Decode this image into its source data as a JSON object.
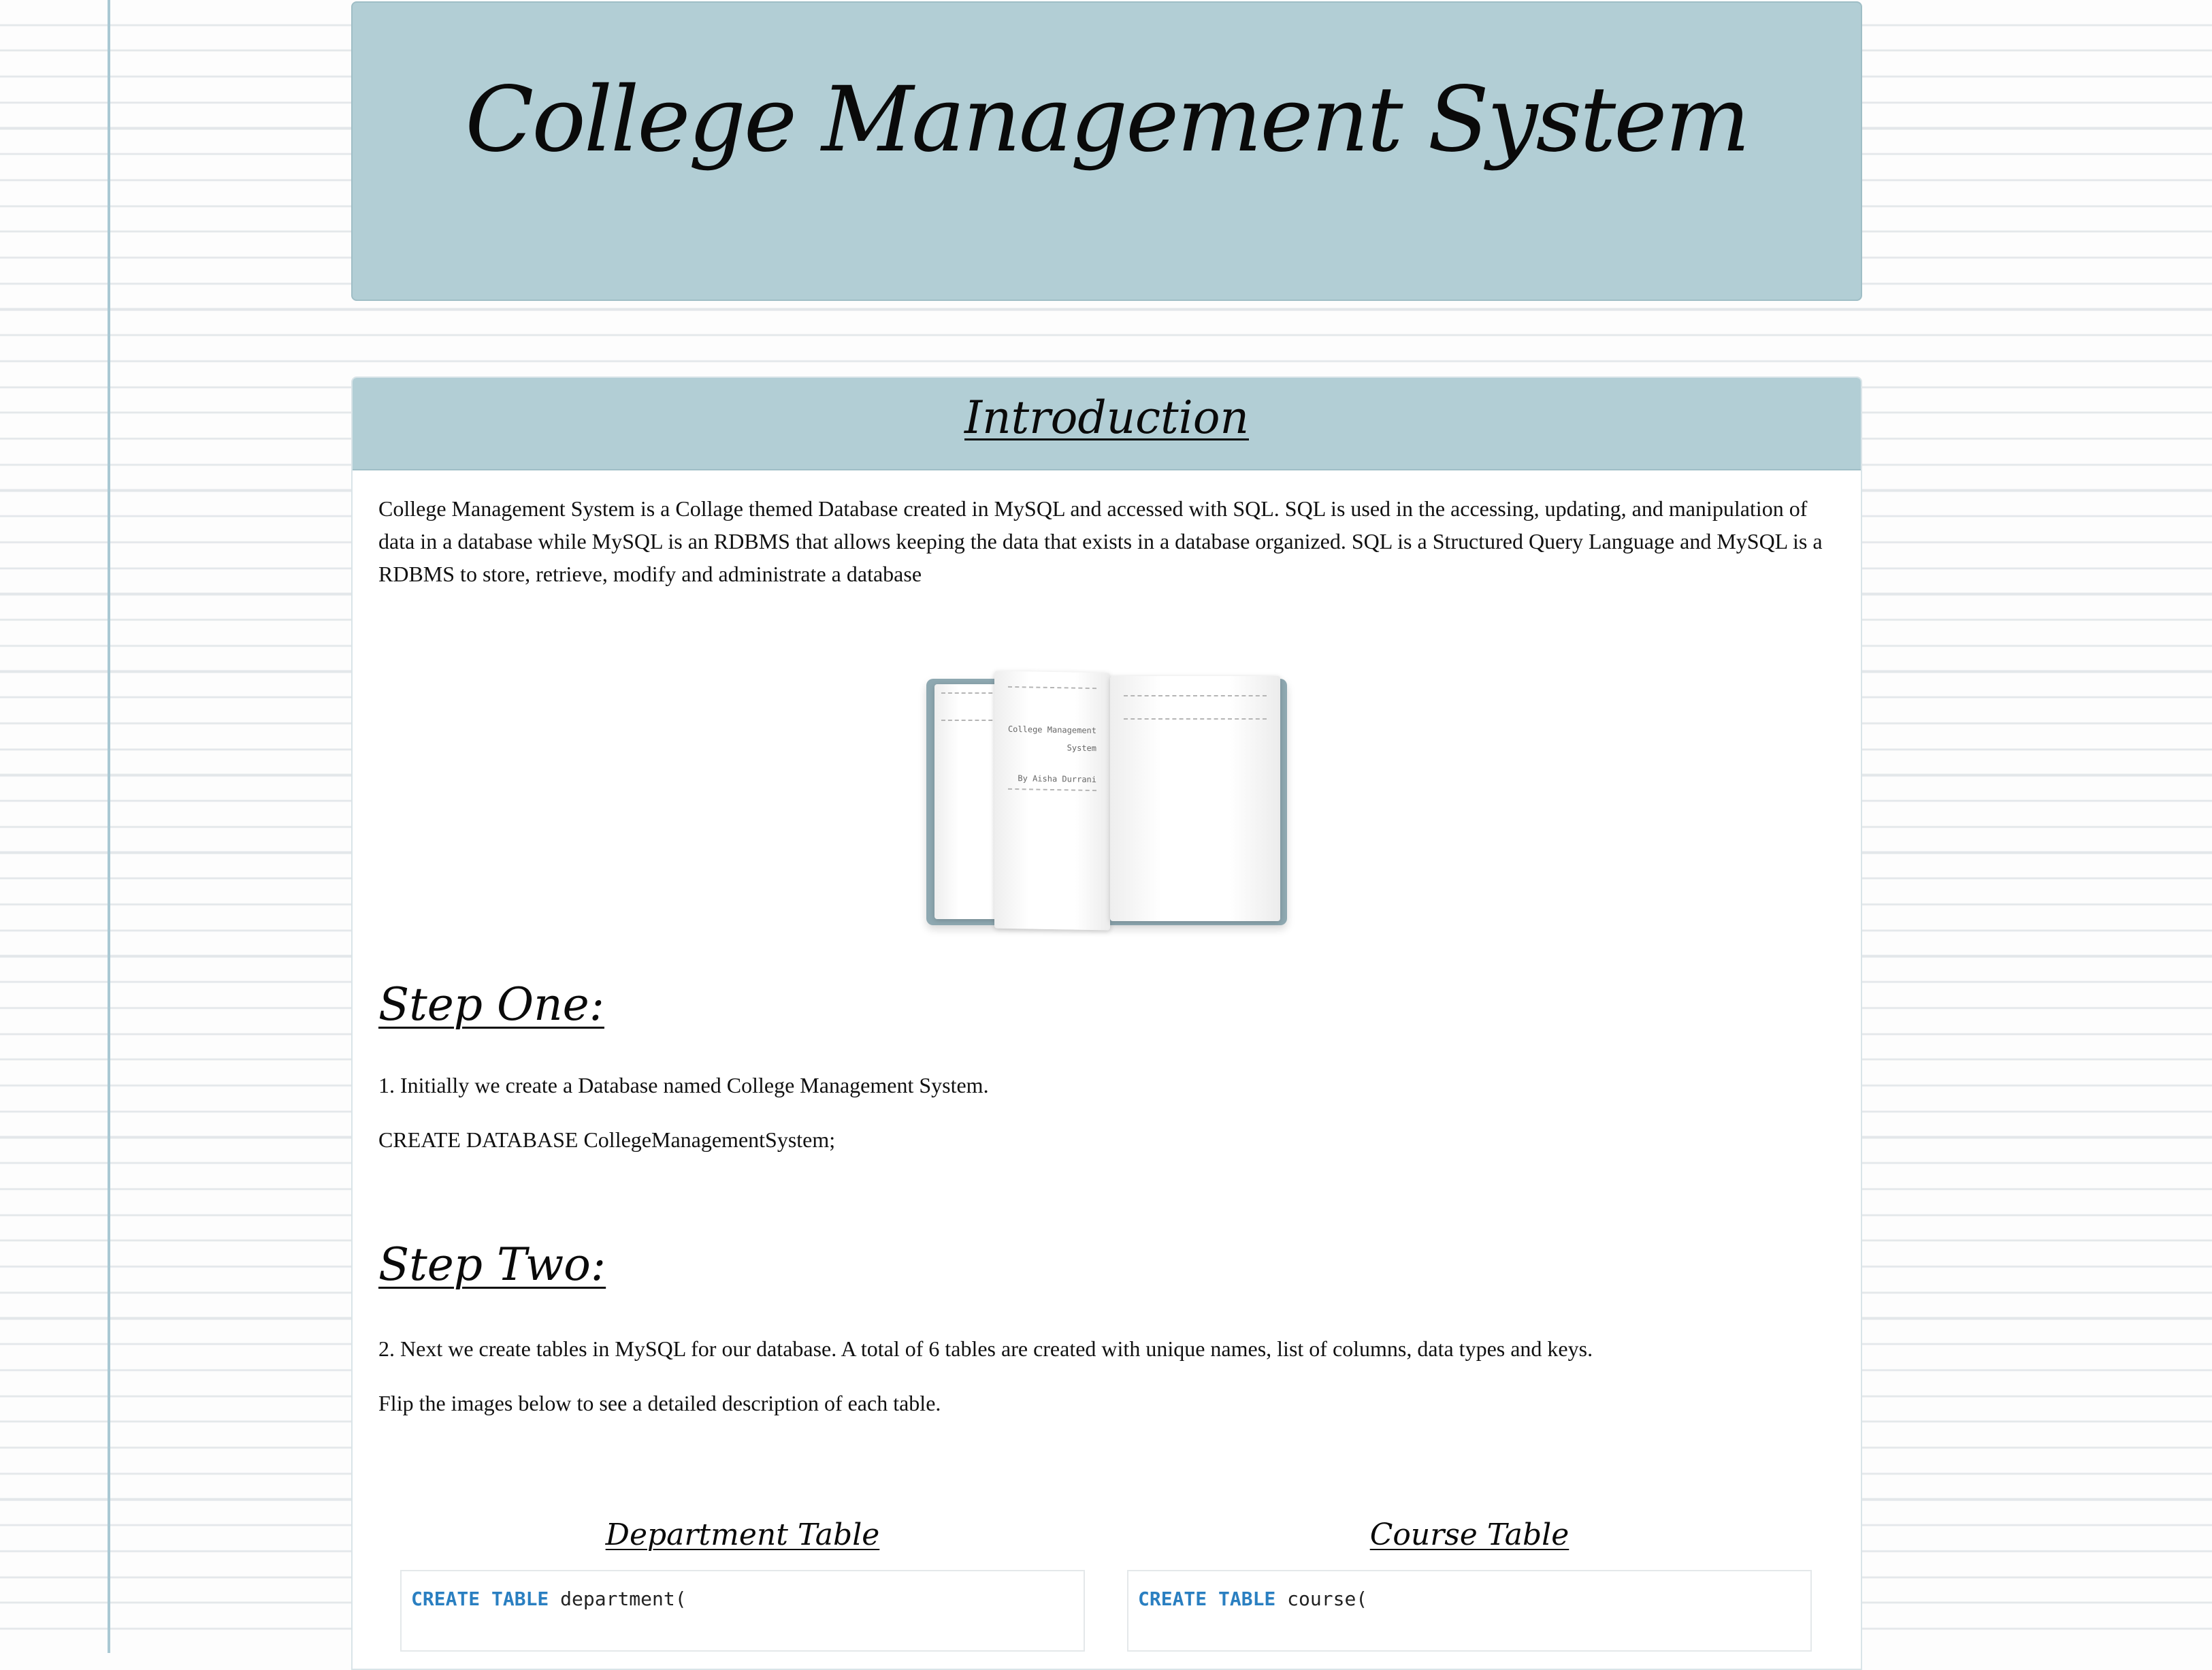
{
  "header": {
    "title": "College Management System"
  },
  "intro": {
    "heading": "Introduction",
    "text": "College Management System is a Collage themed Database created in MySQL and accessed with SQL. SQL is used in the accessing, updating, and manipulation of data in a database while MySQL is an RDBMS that allows keeping the data that exists in a database organized. SQL is a Structured Query Language and MySQL is a RDBMS to store, retrieve, modify and administrate a database"
  },
  "book_image": {
    "icon": "open-book-icon",
    "title_line1": "College Management",
    "title_line2": "System",
    "author": "By Aisha Durrani"
  },
  "step_one": {
    "heading": "Step One:",
    "text": "1. Initially we create a Database named College Management System.",
    "code": "CREATE DATABASE CollegeManagementSystem;"
  },
  "step_two": {
    "heading": "Step Two:",
    "text": "2. Next we create tables in MySQL for our database. A total of 6 tables are created with unique names, list of columns, data types and keys.",
    "hint": "Flip the images below to see a detailed description of each table."
  },
  "tables": [
    {
      "title": "Department Table",
      "code_keyword": "CREATE TABLE",
      "code_rest": " department("
    },
    {
      "title": "Course Table",
      "code_keyword": "CREATE TABLE",
      "code_rest": " course("
    }
  ],
  "colors": {
    "accent": "#b2ced5",
    "margin_line": "#a9c8d3",
    "code_keyword": "#2a7fc1"
  }
}
